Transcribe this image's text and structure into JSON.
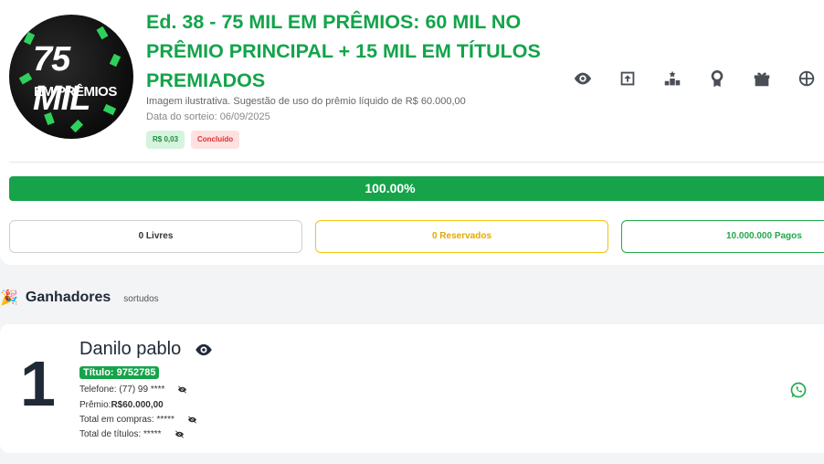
{
  "raffle": {
    "title": "Ed. 38 - 75 MIL EM PRÊMIOS: 60 MIL NO PRÊMIO PRINCIPAL + 15 MIL EM TÍTULOS PREMIADOS",
    "description": "Imagem ilustrativa. Sugestão de uso do prêmio líquido de R$ 60.000,00",
    "draw_date": "Data do sorteio: 06/09/2025",
    "price_badge": "R$ 0,03",
    "status_badge": "Concluído",
    "logo_line1": "75 MIL",
    "logo_line2": "EM PRÊMIOS"
  },
  "actions": [
    "eye-icon",
    "share-icon",
    "podium-icon",
    "award-icon",
    "gift-icon",
    "wheel-icon"
  ],
  "progress": {
    "value": 100,
    "label": "100.00%"
  },
  "stats": {
    "free": "0 Livres",
    "reserved": "0 Reservados",
    "paid": "10.000.000 Pagos"
  },
  "winners_section": {
    "title": "Ganhadores",
    "subtitle": "sortudos"
  },
  "winner": {
    "rank": "1",
    "name": "Danilo pablo",
    "ticket": "Título: 9752785",
    "phone": "Telefone: (77) 99 ****",
    "prize_label": "Prêmio: ",
    "prize_value": "R$60.000,00",
    "total_purchases": "Total em compras: *****",
    "total_tickets": "Total de títulos: *****"
  },
  "colors": {
    "green": "#16a34a",
    "title_green": "#12a44a",
    "yellow": "#f1c40f",
    "red": "#d83232"
  }
}
